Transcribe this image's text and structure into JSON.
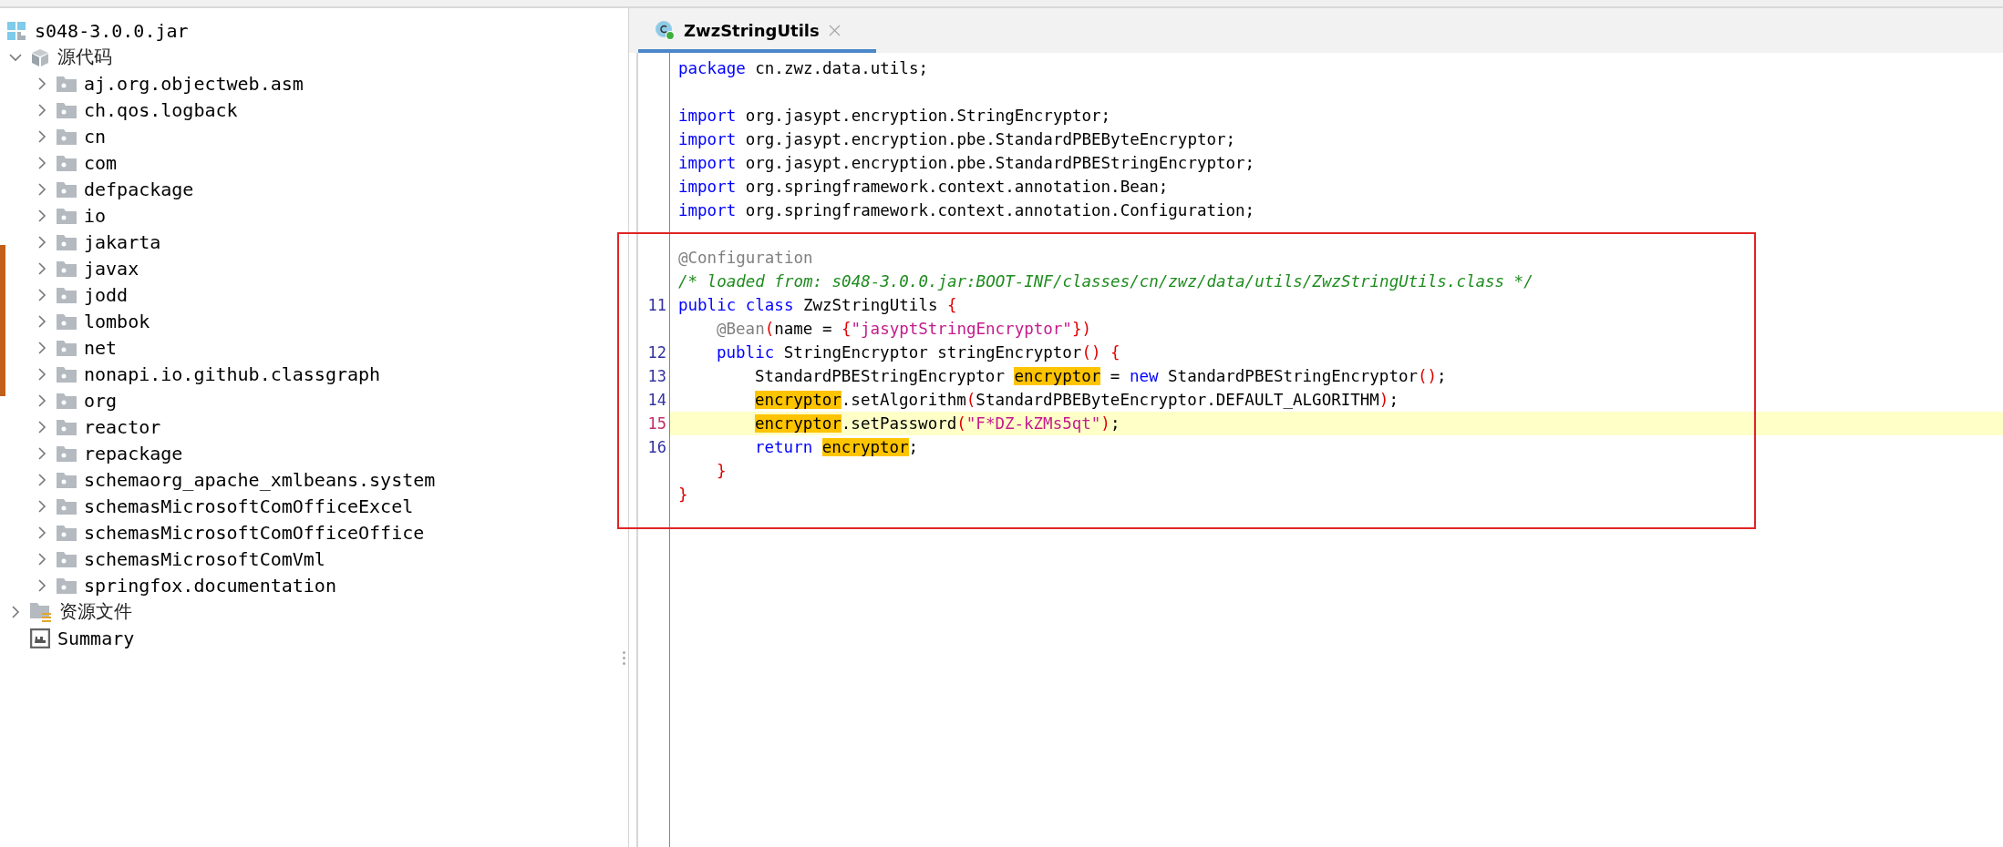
{
  "project_tree": {
    "nodes": [
      {
        "label": "s048-3.0.0.jar",
        "kind": "jar",
        "children": [
          {
            "label": "源代码",
            "kind": "module",
            "expanded": true,
            "children": [
              {
                "label": "aj.org.objectweb.asm",
                "kind": "package",
                "expanded": false
              },
              {
                "label": "ch.qos.logback",
                "kind": "package",
                "expanded": false
              },
              {
                "label": "cn",
                "kind": "package",
                "expanded": false
              },
              {
                "label": "com",
                "kind": "package",
                "expanded": false
              },
              {
                "label": "defpackage",
                "kind": "package",
                "expanded": false
              },
              {
                "label": "io",
                "kind": "package",
                "expanded": false
              },
              {
                "label": "jakarta",
                "kind": "package",
                "expanded": false
              },
              {
                "label": "javax",
                "kind": "package",
                "expanded": false
              },
              {
                "label": "jodd",
                "kind": "package",
                "expanded": false
              },
              {
                "label": "lombok",
                "kind": "package",
                "expanded": false
              },
              {
                "label": "net",
                "kind": "package",
                "expanded": false
              },
              {
                "label": "nonapi.io.github.classgraph",
                "kind": "package",
                "expanded": false
              },
              {
                "label": "org",
                "kind": "package",
                "expanded": false
              },
              {
                "label": "reactor",
                "kind": "package",
                "expanded": false
              },
              {
                "label": "repackage",
                "kind": "package",
                "expanded": false
              },
              {
                "label": "schemaorg_apache_xmlbeans.system",
                "kind": "package",
                "expanded": false
              },
              {
                "label": "schemasMicrosoftComOfficeExcel",
                "kind": "package",
                "expanded": false
              },
              {
                "label": "schemasMicrosoftComOfficeOffice",
                "kind": "package",
                "expanded": false
              },
              {
                "label": "schemasMicrosoftComVml",
                "kind": "package",
                "expanded": false
              },
              {
                "label": "springfox.documentation",
                "kind": "package",
                "expanded": false
              }
            ]
          },
          {
            "label": "资源文件",
            "kind": "resources",
            "expanded": false
          },
          {
            "label": "Summary",
            "kind": "summary"
          }
        ]
      }
    ]
  },
  "editor": {
    "tabs": [
      {
        "label": "ZwzStringUtils",
        "selected": true
      }
    ],
    "lines": [
      {
        "kind": "top",
        "current": false,
        "tokens": [
          {
            "kind": "keyword",
            "text": "package"
          },
          {
            "kind": "plain",
            "text": " cn.zwz.data.utils;"
          }
        ]
      },
      {
        "kind": "blank"
      },
      {
        "kind": "top",
        "current": false,
        "tokens": [
          {
            "kind": "keyword",
            "text": "import"
          },
          {
            "kind": "plain",
            "text": " org.jasypt.encryption.StringEncryptor;"
          }
        ]
      },
      {
        "kind": "top",
        "current": false,
        "tokens": [
          {
            "kind": "keyword",
            "text": "import"
          },
          {
            "kind": "plain",
            "text": " org.jasypt.encryption.pbe.StandardPBEByteEncryptor;"
          }
        ]
      },
      {
        "kind": "top",
        "current": false,
        "tokens": [
          {
            "kind": "keyword",
            "text": "import"
          },
          {
            "kind": "plain",
            "text": " org.jasypt.encryption.pbe.StandardPBEStringEncryptor;"
          }
        ]
      },
      {
        "kind": "top",
        "current": false,
        "tokens": [
          {
            "kind": "keyword",
            "text": "import"
          },
          {
            "kind": "plain",
            "text": " org.springframework.context.annotation.Bean;"
          }
        ]
      },
      {
        "kind": "top",
        "current": false,
        "tokens": [
          {
            "kind": "keyword",
            "text": "import"
          },
          {
            "kind": "plain",
            "text": " org.springframework.context.annotation.Configuration;"
          }
        ]
      },
      {
        "kind": "blank"
      },
      {
        "kind": "top",
        "current": false,
        "tokens": [
          {
            "kind": "annotation",
            "text": "@Configuration"
          }
        ]
      },
      {
        "kind": "top",
        "current": false,
        "tokens": [
          {
            "kind": "comment",
            "text": "/* loaded from: s048-3.0.0.jar:BOOT-INF/classes/cn/zwz/data/utils/ZwzStringUtils.class */"
          }
        ]
      },
      {
        "kind": "top",
        "number": "11",
        "current": false,
        "tokens": [
          {
            "kind": "keyword",
            "text": "public class"
          },
          {
            "kind": "plain",
            "text": " ZwzStringUtils "
          },
          {
            "kind": "brace",
            "text": "{"
          }
        ]
      },
      {
        "kind": "member",
        "current": false,
        "tokens": [
          {
            "kind": "annotation",
            "text": "@Bean"
          },
          {
            "kind": "brace",
            "text": "("
          },
          {
            "kind": "plain",
            "text": "name = "
          },
          {
            "kind": "brace",
            "text": "{"
          },
          {
            "kind": "string",
            "text": "\"jasyptStringEncryptor\""
          },
          {
            "kind": "brace",
            "text": "})"
          }
        ]
      },
      {
        "kind": "member",
        "number": "12",
        "current": false,
        "tokens": [
          {
            "kind": "keyword",
            "text": "public"
          },
          {
            "kind": "plain",
            "text": " StringEncryptor stringEncryptor"
          },
          {
            "kind": "brace",
            "text": "() {"
          }
        ]
      },
      {
        "kind": "body",
        "number": "13",
        "current": false,
        "tokens": [
          {
            "kind": "plain",
            "text": "StandardPBEStringEncryptor "
          },
          {
            "kind": "occurrence",
            "text": "encryptor"
          },
          {
            "kind": "plain",
            "text": " = "
          },
          {
            "kind": "keyword",
            "text": "new"
          },
          {
            "kind": "plain",
            "text": " StandardPBEStringEncryptor"
          },
          {
            "kind": "brace",
            "text": "()"
          },
          {
            "kind": "plain",
            "text": ";"
          }
        ]
      },
      {
        "kind": "body",
        "number": "14",
        "current": false,
        "tokens": [
          {
            "kind": "occurrence",
            "text": "encryptor"
          },
          {
            "kind": "plain",
            "text": ".setAlgorithm"
          },
          {
            "kind": "brace",
            "text": "("
          },
          {
            "kind": "plain",
            "text": "StandardPBEByteEncryptor.DEFAULT_ALGORITHM"
          },
          {
            "kind": "brace",
            "text": ")"
          },
          {
            "kind": "plain",
            "text": ";"
          }
        ]
      },
      {
        "kind": "body",
        "number": "15",
        "current": true,
        "tokens": [
          {
            "kind": "occurrence",
            "text": "encryptor"
          },
          {
            "kind": "plain",
            "text": ".setPassword"
          },
          {
            "kind": "brace",
            "text": "("
          },
          {
            "kind": "string",
            "text": "\"F*DZ-kZMs5qt\""
          },
          {
            "kind": "brace",
            "text": ")"
          },
          {
            "kind": "plain",
            "text": ";"
          }
        ]
      },
      {
        "kind": "body",
        "number": "16",
        "current": false,
        "tokens": [
          {
            "kind": "keyword",
            "text": "return "
          },
          {
            "kind": "occurrence",
            "text": "encryptor"
          },
          {
            "kind": "plain",
            "text": ";"
          }
        ]
      },
      {
        "kind": "member",
        "current": false,
        "tokens": [
          {
            "kind": "brace",
            "text": "}"
          }
        ]
      },
      {
        "kind": "top",
        "current": false,
        "tokens": [
          {
            "kind": "brace",
            "text": "}"
          }
        ]
      }
    ]
  }
}
